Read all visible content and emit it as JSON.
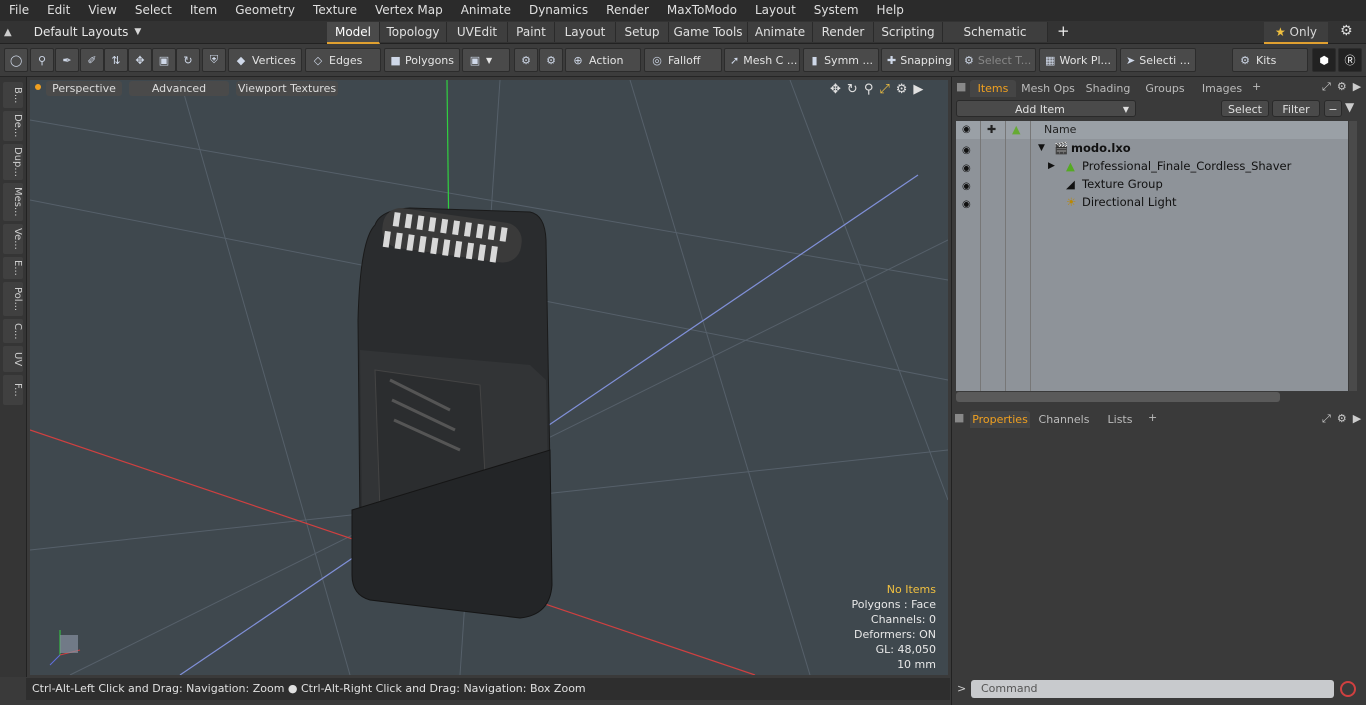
{
  "menu": [
    "File",
    "Edit",
    "View",
    "Select",
    "Item",
    "Geometry",
    "Texture",
    "Vertex Map",
    "Animate",
    "Dynamics",
    "Render",
    "MaxToModo",
    "Layout",
    "System",
    "Help"
  ],
  "layout_selector": "Default Layouts",
  "tabs": [
    "Model",
    "Topology",
    "UVEdit",
    "Paint",
    "Layout",
    "Setup",
    "Game Tools",
    "Animate",
    "Render",
    "Scripting",
    "Schematic Fusion"
  ],
  "tab_add": "+",
  "only_label": "Only",
  "toolbar": {
    "vertices": "Vertices",
    "edges": "Edges",
    "polygons": "Polygons",
    "action": "Action",
    "falloff": "Falloff",
    "mesh": "Mesh C ...",
    "symmetry": "Symm ...",
    "snapping": "Snapping",
    "select_t": "Select T...",
    "work_plane": "Work Pl...",
    "selection": "Selecti ...",
    "kits": "Kits"
  },
  "left_tabs": [
    "B...",
    "De...",
    "Dup...",
    "Mes...",
    "Ve...",
    "E...",
    "Pol...",
    "C...",
    "UV",
    "F..."
  ],
  "viewport": {
    "perspective": "Perspective",
    "advanced": "Advanced",
    "textures": "Viewport Textures",
    "stats": {
      "no_items": "No Items",
      "polygons": "Polygons : Face",
      "channels": "Channels: 0",
      "deformers": "Deformers: ON",
      "gl": "GL: 48,050",
      "scale": "10 mm"
    }
  },
  "status": "Ctrl-Alt-Left Click and Drag: Navigation: Zoom ● Ctrl-Alt-Right Click and Drag: Navigation: Box Zoom",
  "items_panel": {
    "tabs": [
      "Items",
      "Mesh Ops",
      "Shading",
      "Groups",
      "Images"
    ],
    "add_item": "Add Item",
    "select": "Select",
    "filter": "Filter",
    "name_header": "Name",
    "rows": [
      "modo.lxo",
      "Professional_Finale_Cordless_Shaver",
      "Texture Group",
      "Directional Light"
    ]
  },
  "props_panel": {
    "tabs": [
      "Properties",
      "Channels",
      "Lists"
    ]
  },
  "command_placeholder": "Command",
  "colors": {
    "accent": "#f0a020",
    "viewport_bg": "#3f484e",
    "list_bg": "#8e9399"
  }
}
